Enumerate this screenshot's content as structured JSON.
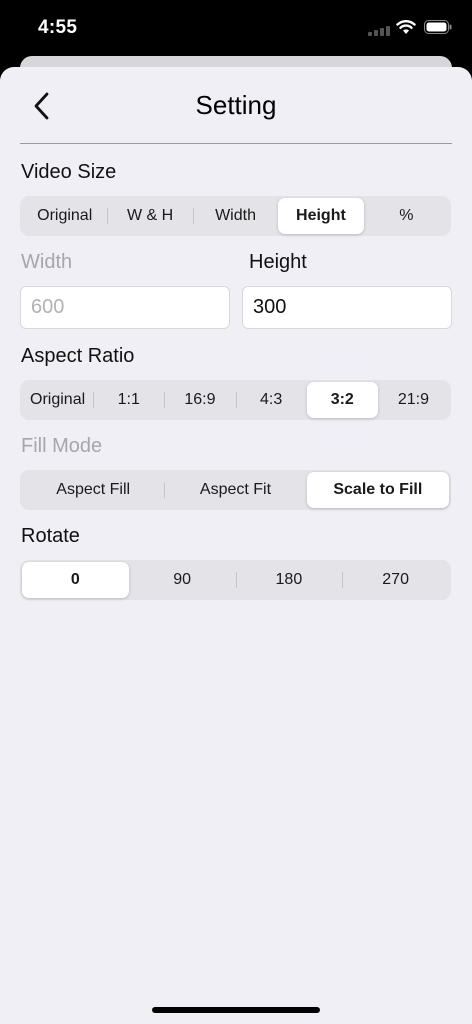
{
  "status_bar": {
    "time": "4:55"
  },
  "nav": {
    "title": "Setting"
  },
  "video_size": {
    "label": "Video Size",
    "segments": [
      "Original",
      "W & H",
      "Width",
      "Height",
      "%"
    ],
    "selected": "Height"
  },
  "dimensions": {
    "width_label": "Width",
    "width_value": "600",
    "height_label": "Height",
    "height_value": "300"
  },
  "aspect_ratio": {
    "label": "Aspect Ratio",
    "segments": [
      "Original",
      "1:1",
      "16:9",
      "4:3",
      "3:2",
      "21:9"
    ],
    "selected": "3:2"
  },
  "fill_mode": {
    "label": "Fill Mode",
    "segments": [
      "Aspect Fill",
      "Aspect Fit",
      "Scale to Fill"
    ],
    "selected": "Scale to Fill"
  },
  "rotate": {
    "label": "Rotate",
    "segments": [
      "0",
      "90",
      "180",
      "270"
    ],
    "selected": "0"
  },
  "icons": {
    "back": "chevron-left-icon",
    "signal": "cellular-signal-icon",
    "wifi": "wifi-icon",
    "battery": "battery-icon"
  },
  "colors": {
    "background": "#f0eff5",
    "segment_track": "#e3e3e8",
    "muted_text": "#a6a6ab"
  }
}
